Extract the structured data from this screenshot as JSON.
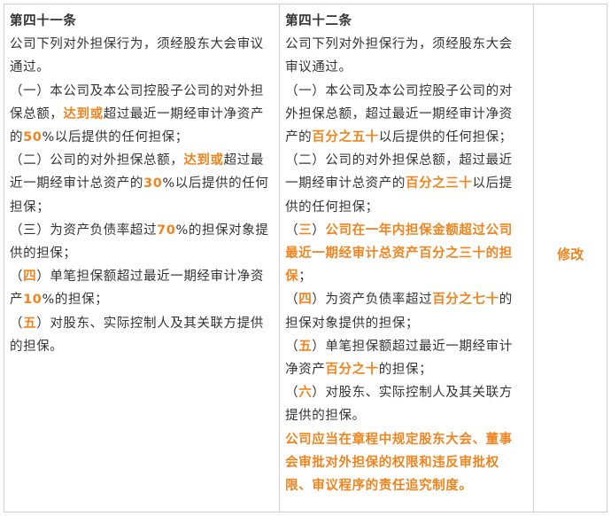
{
  "old_col": {
    "lines": [
      [
        {
          "t": "第四十一条",
          "s": "b"
        }
      ],
      [
        {
          "t": "公司下列对外担保行为，须经股东大会审议"
        }
      ],
      [
        {
          "t": "通过。"
        }
      ],
      [
        {
          "t": "（一）本公司及本公司控股子公司的对外担"
        }
      ],
      [
        {
          "t": "保总额，"
        },
        {
          "t": "达到或",
          "s": "hl"
        },
        {
          "t": "超过最近一期经审计净资产"
        }
      ],
      [
        {
          "t": "的"
        },
        {
          "t": "50",
          "s": "hl"
        },
        {
          "t": "%以后提供的任何担保；"
        }
      ],
      [
        {
          "t": "（二）公司的对外担保总额，"
        },
        {
          "t": "达到或",
          "s": "hl"
        },
        {
          "t": "超过最"
        }
      ],
      [
        {
          "t": "近一期经审计总资产的"
        },
        {
          "t": "30",
          "s": "hl"
        },
        {
          "t": "%以后提供的任何"
        }
      ],
      [
        {
          "t": "担保；"
        }
      ],
      [
        {
          "t": "（三）为资产负债率超过"
        },
        {
          "t": "70",
          "s": "hl"
        },
        {
          "t": "%的担保对象提"
        }
      ],
      [
        {
          "t": "供的担保；"
        }
      ],
      [
        {
          "t": "（"
        },
        {
          "t": "四",
          "s": "hl"
        },
        {
          "t": "）单笔担保额超过最近一期经审计净资"
        }
      ],
      [
        {
          "t": "产"
        },
        {
          "t": "10",
          "s": "hl"
        },
        {
          "t": "%的担保；"
        }
      ],
      [
        {
          "t": "（"
        },
        {
          "t": "五",
          "s": "hl"
        },
        {
          "t": "）对股东、实际控制人及其关联方提供"
        }
      ],
      [
        {
          "t": "的担保。"
        }
      ]
    ]
  },
  "new_col": {
    "lines": [
      [
        {
          "t": "第四十二条",
          "s": "b"
        }
      ],
      [
        {
          "t": "公司下列对外担保行为，须经股东大会"
        }
      ],
      [
        {
          "t": "审议通过。"
        }
      ],
      [
        {
          "t": "（一）本公司及本公司控股子公司的对"
        }
      ],
      [
        {
          "t": "外担保总额，超过最近一期经审计净资"
        }
      ],
      [
        {
          "t": "产的"
        },
        {
          "t": "百分之五十",
          "s": "hl"
        },
        {
          "t": "以后提供的任何担保；"
        }
      ],
      [
        {
          "t": "（二）公司的对外担保总额，超过最近"
        }
      ],
      [
        {
          "t": "一期经审计总资产的"
        },
        {
          "t": "百分之三十",
          "s": "hl"
        },
        {
          "t": "以后提"
        }
      ],
      [
        {
          "t": "供的任何担保；"
        }
      ],
      [
        {
          "t": "（"
        },
        {
          "t": "三",
          "s": "hl"
        },
        {
          "t": "）"
        },
        {
          "t": "公司在一年内担保金额超过公司",
          "s": "hl"
        }
      ],
      [
        {
          "t": "最近一期经审计总资产百分之三十的担",
          "s": "hl"
        }
      ],
      [
        {
          "t": "保",
          "s": "hl"
        },
        {
          "t": "；"
        }
      ],
      [
        {
          "t": "（"
        },
        {
          "t": "四",
          "s": "hl"
        },
        {
          "t": "）为资产负债率超过"
        },
        {
          "t": "百分之七十",
          "s": "hl"
        },
        {
          "t": "的"
        }
      ],
      [
        {
          "t": "担保对象提供的担保；"
        }
      ],
      [
        {
          "t": "（"
        },
        {
          "t": "五",
          "s": "hl"
        },
        {
          "t": "）单笔担保额超过最近一期经审计"
        }
      ],
      [
        {
          "t": "净资产"
        },
        {
          "t": "百分之十",
          "s": "hl"
        },
        {
          "t": "的担保；"
        }
      ],
      [
        {
          "t": "（"
        },
        {
          "t": "六",
          "s": "hl"
        },
        {
          "t": "）对股东、实际控制人及其关联方"
        }
      ],
      [
        {
          "t": "提供的担保。"
        }
      ],
      [
        {
          "t": "公司应当在章程中规定股东大会、董事",
          "s": "hl"
        }
      ],
      [
        {
          "t": "会审批对外担保的权限和违反审批权",
          "s": "hl"
        }
      ],
      [
        {
          "t": "限、审议程序的责任追究制度。",
          "s": "hl"
        }
      ]
    ]
  },
  "action": {
    "label": "修改"
  },
  "colors": {
    "highlight": "#f0841e",
    "text": "#333333",
    "border": "#cfcfcf"
  }
}
